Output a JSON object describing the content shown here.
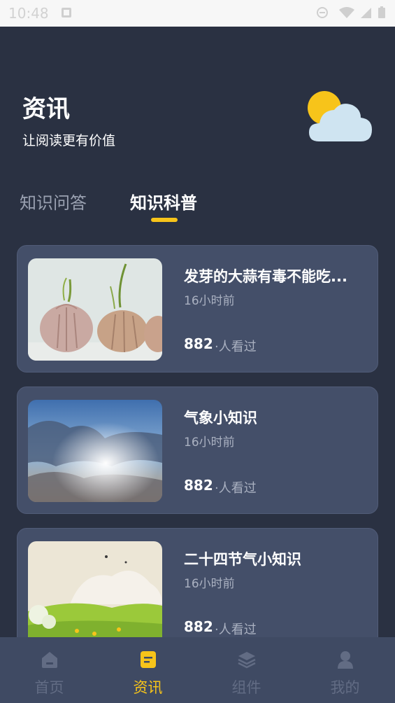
{
  "statusbar": {
    "time": "10:48"
  },
  "header": {
    "title": "资讯",
    "subtitle": "让阅读更有价值"
  },
  "tabs": [
    {
      "label": "知识问答",
      "active": false
    },
    {
      "label": "知识科普",
      "active": true
    }
  ],
  "articles": [
    {
      "title": "发芽的大蒜有毒不能吃...",
      "time": "16小时前",
      "views": "882",
      "views_suffix": "·人看过",
      "image": "sprouting-garlic"
    },
    {
      "title": "气象小知识",
      "time": "16小时前",
      "views": "882",
      "views_suffix": "·人看过",
      "image": "sun-rays-clouds"
    },
    {
      "title": "二十四节气小知识",
      "time": "16小时前",
      "views": "882",
      "views_suffix": "·人看过",
      "image": "spring-meadow"
    }
  ],
  "bottom_nav": [
    {
      "label": "首页",
      "icon": "home-icon",
      "active": false
    },
    {
      "label": "资讯",
      "icon": "news-icon",
      "active": true
    },
    {
      "label": "组件",
      "icon": "layers-icon",
      "active": false
    },
    {
      "label": "我的",
      "icon": "user-icon",
      "active": false
    }
  ],
  "colors": {
    "background": "#2a3142",
    "card": "#444f69",
    "accent": "#f7c41a",
    "nav": "#3f4a63"
  }
}
